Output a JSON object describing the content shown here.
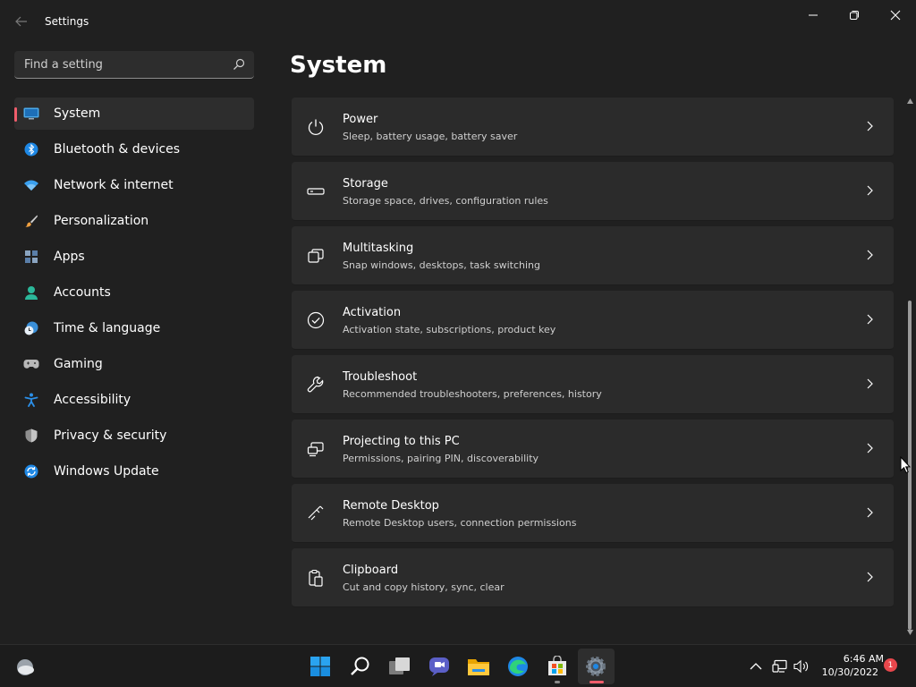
{
  "window": {
    "title": "Settings"
  },
  "search": {
    "placeholder": "Find a setting"
  },
  "sidebar": {
    "items": [
      {
        "label": "System",
        "icon": "monitor-icon",
        "active": true
      },
      {
        "label": "Bluetooth & devices",
        "icon": "bluetooth-icon"
      },
      {
        "label": "Network & internet",
        "icon": "wifi-icon"
      },
      {
        "label": "Personalization",
        "icon": "brush-icon"
      },
      {
        "label": "Apps",
        "icon": "apps-icon"
      },
      {
        "label": "Accounts",
        "icon": "person-icon"
      },
      {
        "label": "Time & language",
        "icon": "clock-globe-icon"
      },
      {
        "label": "Gaming",
        "icon": "gamepad-icon"
      },
      {
        "label": "Accessibility",
        "icon": "accessibility-icon"
      },
      {
        "label": "Privacy & security",
        "icon": "shield-icon"
      },
      {
        "label": "Windows Update",
        "icon": "update-icon"
      }
    ]
  },
  "main": {
    "title": "System",
    "cards": [
      {
        "title": "Power",
        "subtitle": "Sleep, battery usage, battery saver",
        "icon": "power-icon"
      },
      {
        "title": "Storage",
        "subtitle": "Storage space, drives, configuration rules",
        "icon": "storage-icon"
      },
      {
        "title": "Multitasking",
        "subtitle": "Snap windows, desktops, task switching",
        "icon": "multitasking-icon"
      },
      {
        "title": "Activation",
        "subtitle": "Activation state, subscriptions, product key",
        "icon": "activation-icon"
      },
      {
        "title": "Troubleshoot",
        "subtitle": "Recommended troubleshooters, preferences, history",
        "icon": "wrench-icon"
      },
      {
        "title": "Projecting to this PC",
        "subtitle": "Permissions, pairing PIN, discoverability",
        "icon": "projecting-icon"
      },
      {
        "title": "Remote Desktop",
        "subtitle": "Remote Desktop users, connection permissions",
        "icon": "remote-desktop-icon"
      },
      {
        "title": "Clipboard",
        "subtitle": "Cut and copy history, sync, clear",
        "icon": "clipboard-icon"
      }
    ]
  },
  "taskbar": {
    "clock_time": "6:46 AM",
    "clock_date": "10/30/2022",
    "notification_count": "1"
  },
  "colors": {
    "accent": "#f05d6b",
    "background": "#202020",
    "card": "#2b2b2b",
    "taskbar": "#1c1c1c"
  }
}
